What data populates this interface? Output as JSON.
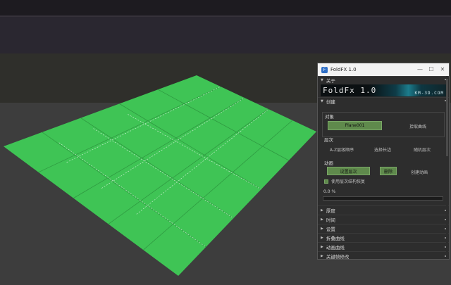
{
  "window": {
    "title": "FoldFX 1.0",
    "minimize": "—",
    "maximize": "☐",
    "close": "✕"
  },
  "about": {
    "header": "关于",
    "banner_title": "FoldFx 1.0",
    "banner_url": "KM-3D.COM"
  },
  "create": {
    "header": "创建",
    "object_label": "对象",
    "pick_object": "Plane001",
    "select_curve": "拾取曲线",
    "hierarchy_label": "层次",
    "auto_hierarchy": "A-Z层级顺序",
    "select_edge": "选择长边",
    "random_hierarchy": "随机层次",
    "animation_label": "动画",
    "create_animation": "设置层次",
    "delete": "删除",
    "create_anim": "创建动画",
    "use_hierarchy_checkbox": "使用层次结构恢复",
    "progress_text": "0.0 %",
    "progress_value": 0
  },
  "rollouts": [
    {
      "label": "厚度"
    },
    {
      "label": "时间"
    },
    {
      "label": "设置"
    },
    {
      "label": "折叠曲线"
    },
    {
      "label": "动画曲线"
    },
    {
      "label": "关键帧修改"
    }
  ],
  "colors": {
    "plane": "#3fc455",
    "accent_green": "#5f8a4c",
    "panel_bg": "#2d2d2d"
  }
}
